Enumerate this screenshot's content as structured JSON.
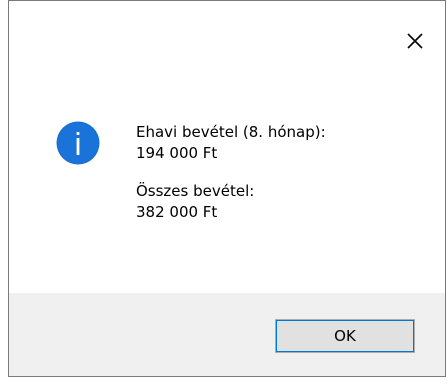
{
  "dialog": {
    "close_icon": "close-icon",
    "info_icon": "info-icon",
    "accent_color": "#0078d7",
    "message": {
      "monthly_label": "Ehavi bevétel (8. hónap):",
      "monthly_value": "194 000 Ft",
      "total_label": "Összes bevétel:",
      "total_value": "382 000 Ft"
    },
    "ok_label": "OK"
  }
}
